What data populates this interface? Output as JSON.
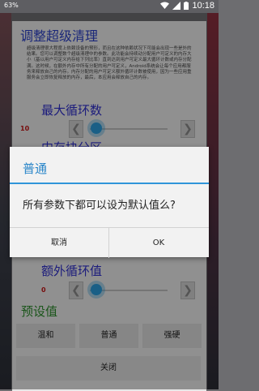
{
  "statusbar": {
    "left_badge": "63%",
    "time": "10:18"
  },
  "main_dialog": {
    "title": "调整超级清理",
    "description": "超级清理很大程度上依赖设备的预形，而且在这种依赖状况下可能会出现一些是外的结果。您可以调整数个超级清理中的参数。此功能会持续动分配用户可定义的内存大小（基以用户可定义内存给下列比率）直到达到用户可定义最大循环计数或内存分配满。这时候，在额外内存中所有分配的用户可定义，Android系统会让每个应用都服务来释放自己的内存。内存分配的用户可定义额外循环计数被使用，因为一些应用重服务会立即恢复释放的内存，最后，本应用会释放自己的内存。",
    "section1": {
      "title": "最大循环数",
      "value": "10"
    },
    "section2": {
      "title": "内存块分区"
    },
    "section3": {
      "title": "额外循环值",
      "value": "0"
    },
    "presets": {
      "title": "预设值",
      "buttons": [
        "温和",
        "普通",
        "强硬"
      ]
    },
    "close_label": "关闭"
  },
  "alert": {
    "title": "普通",
    "message": "所有参数下都可以设为默认值么?",
    "cancel": "取消",
    "ok": "OK"
  },
  "colors": {
    "accent": "#2f95d9",
    "title_blue": "#2b3fc4",
    "value_red": "#c01515",
    "preset_green": "#2a8a2a"
  }
}
